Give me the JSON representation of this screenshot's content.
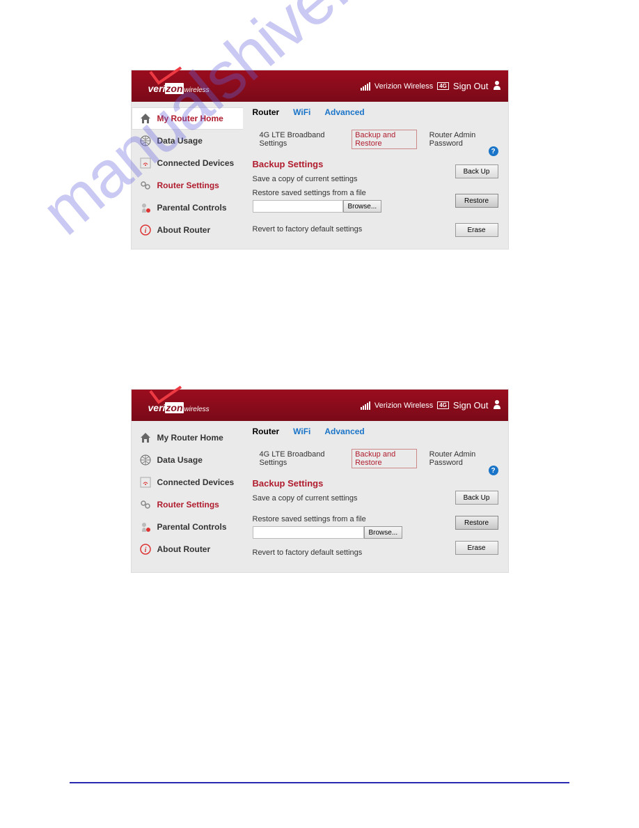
{
  "watermark": "manualshive.com",
  "header": {
    "brand_prefix": "veri",
    "brand_suffix": "zon",
    "brand_sub": "wireless",
    "carrier": "Verizion Wireless",
    "fourg": "4G",
    "signout": "Sign Out"
  },
  "sidebar": {
    "items": [
      {
        "id": "my-router-home",
        "label": "My Router Home"
      },
      {
        "id": "data-usage",
        "label": "Data Usage"
      },
      {
        "id": "connected-devices",
        "label": "Connected Devices"
      },
      {
        "id": "router-settings",
        "label": "Router Settings"
      },
      {
        "id": "parental-controls",
        "label": "Parental Controls"
      },
      {
        "id": "about-router",
        "label": "About Router"
      }
    ]
  },
  "tabs": {
    "router": "Router",
    "wifi": "WiFi",
    "advanced": "Advanced"
  },
  "subtabs": {
    "lte": "4G LTE Broadband Settings",
    "backup": "Backup and Restore",
    "admin": "Router Admin Password"
  },
  "section": {
    "title": "Backup Settings",
    "save_copy": "Save a copy of current settings",
    "restore_file": "Restore saved settings from a file",
    "revert": "Revert to factory default settings",
    "browse": "Browse...",
    "backup_btn": "Back Up",
    "restore_btn": "Restore",
    "erase_btn": "Erase",
    "help": "?"
  }
}
